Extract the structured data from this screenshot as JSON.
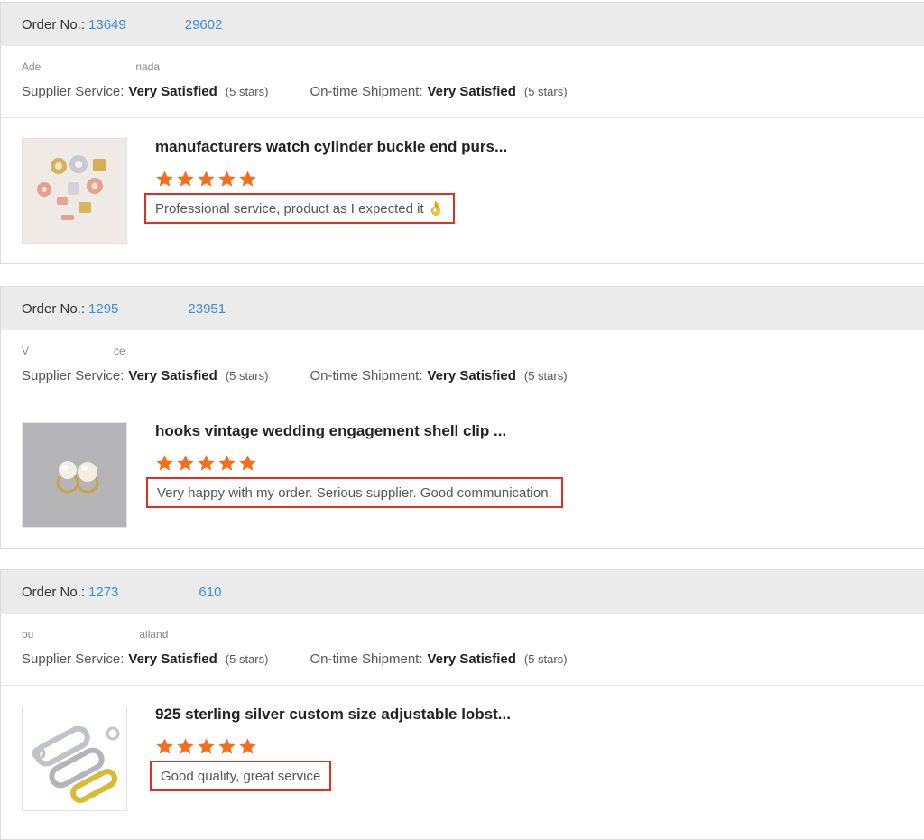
{
  "colors": {
    "header_bg": "#ebebeb",
    "order_link": "#3b8ed0",
    "star": "#f36f1e",
    "highlight_border": "#e03024"
  },
  "orders": [
    {
      "order_label": "Order No.:",
      "order_number_start": "13649",
      "order_number_end": "29602",
      "buyer_start": "Ade",
      "buyer_end": "nada",
      "supplier_service_label": "Supplier Service:",
      "supplier_service_value": "Very Satisfied",
      "supplier_service_stars": "(5 stars)",
      "shipment_label": "On-time Shipment:",
      "shipment_value": "Very Satisfied",
      "shipment_stars": "(5 stars)",
      "product_title": "manufacturers watch cylinder buckle end purs...",
      "rating": 5,
      "comment": "Professional service, product as I expected it",
      "comment_emoji": "👌",
      "thumbnail_icon": "jewelry-clasps-thumbnail"
    },
    {
      "order_label": "Order No.:",
      "order_number_start": "1295",
      "order_number_end": "23951",
      "buyer_start": "V",
      "buyer_end": "ce",
      "supplier_service_label": "Supplier Service:",
      "supplier_service_value": "Very Satisfied",
      "supplier_service_stars": "(5 stars)",
      "shipment_label": "On-time Shipment:",
      "shipment_value": "Very Satisfied",
      "shipment_stars": "(5 stars)",
      "product_title": "hooks vintage wedding engagement shell clip ...",
      "rating": 5,
      "comment": "Very happy with my order. Serious supplier. Good communication.",
      "comment_emoji": "",
      "thumbnail_icon": "pearl-earrings-thumbnail"
    },
    {
      "order_label": "Order No.:",
      "order_number_start": "1273",
      "order_number_end": "610",
      "buyer_start": "pu",
      "buyer_end": "ailand",
      "supplier_service_label": "Supplier Service:",
      "supplier_service_value": "Very Satisfied",
      "supplier_service_stars": "(5 stars)",
      "shipment_label": "On-time Shipment:",
      "shipment_value": "Very Satisfied",
      "shipment_stars": "(5 stars)",
      "product_title": "925 sterling silver custom size adjustable lobst...",
      "rating": 5,
      "comment": "Good quality, great service",
      "comment_emoji": "",
      "thumbnail_icon": "lobster-clasps-thumbnail"
    }
  ]
}
